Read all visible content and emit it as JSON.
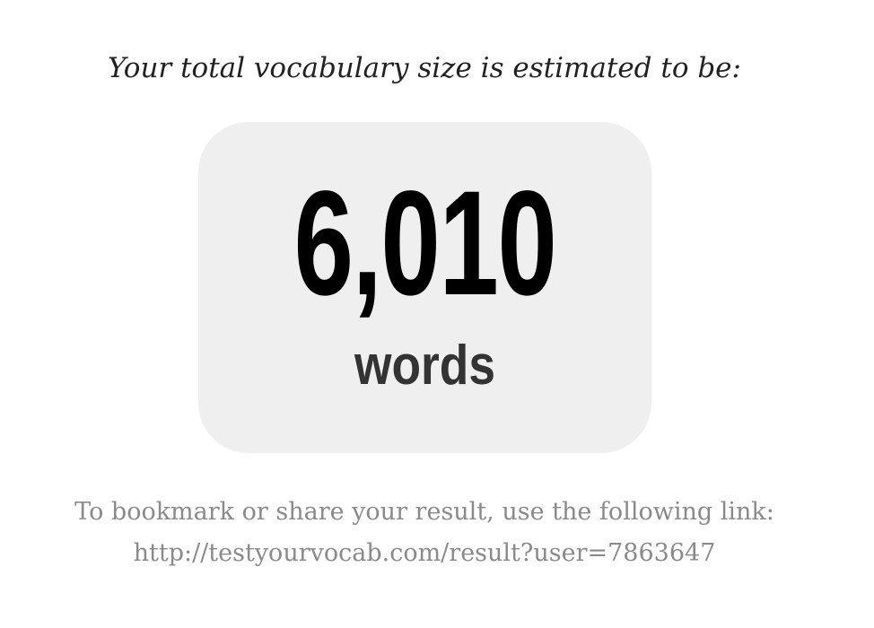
{
  "headline": "Your total vocabulary size is estimated to be:",
  "result": {
    "count": "6,010",
    "unit": "words"
  },
  "share": {
    "text": "To bookmark or share your result, use the following link:",
    "link": "http://testyourvocab.com/result?user=7863647"
  },
  "colors": {
    "background": "#ffffff",
    "box_background": "#efefef",
    "headline": "#222222",
    "count": "#000000",
    "unit": "#333333",
    "share_text": "#8a8a8a"
  }
}
